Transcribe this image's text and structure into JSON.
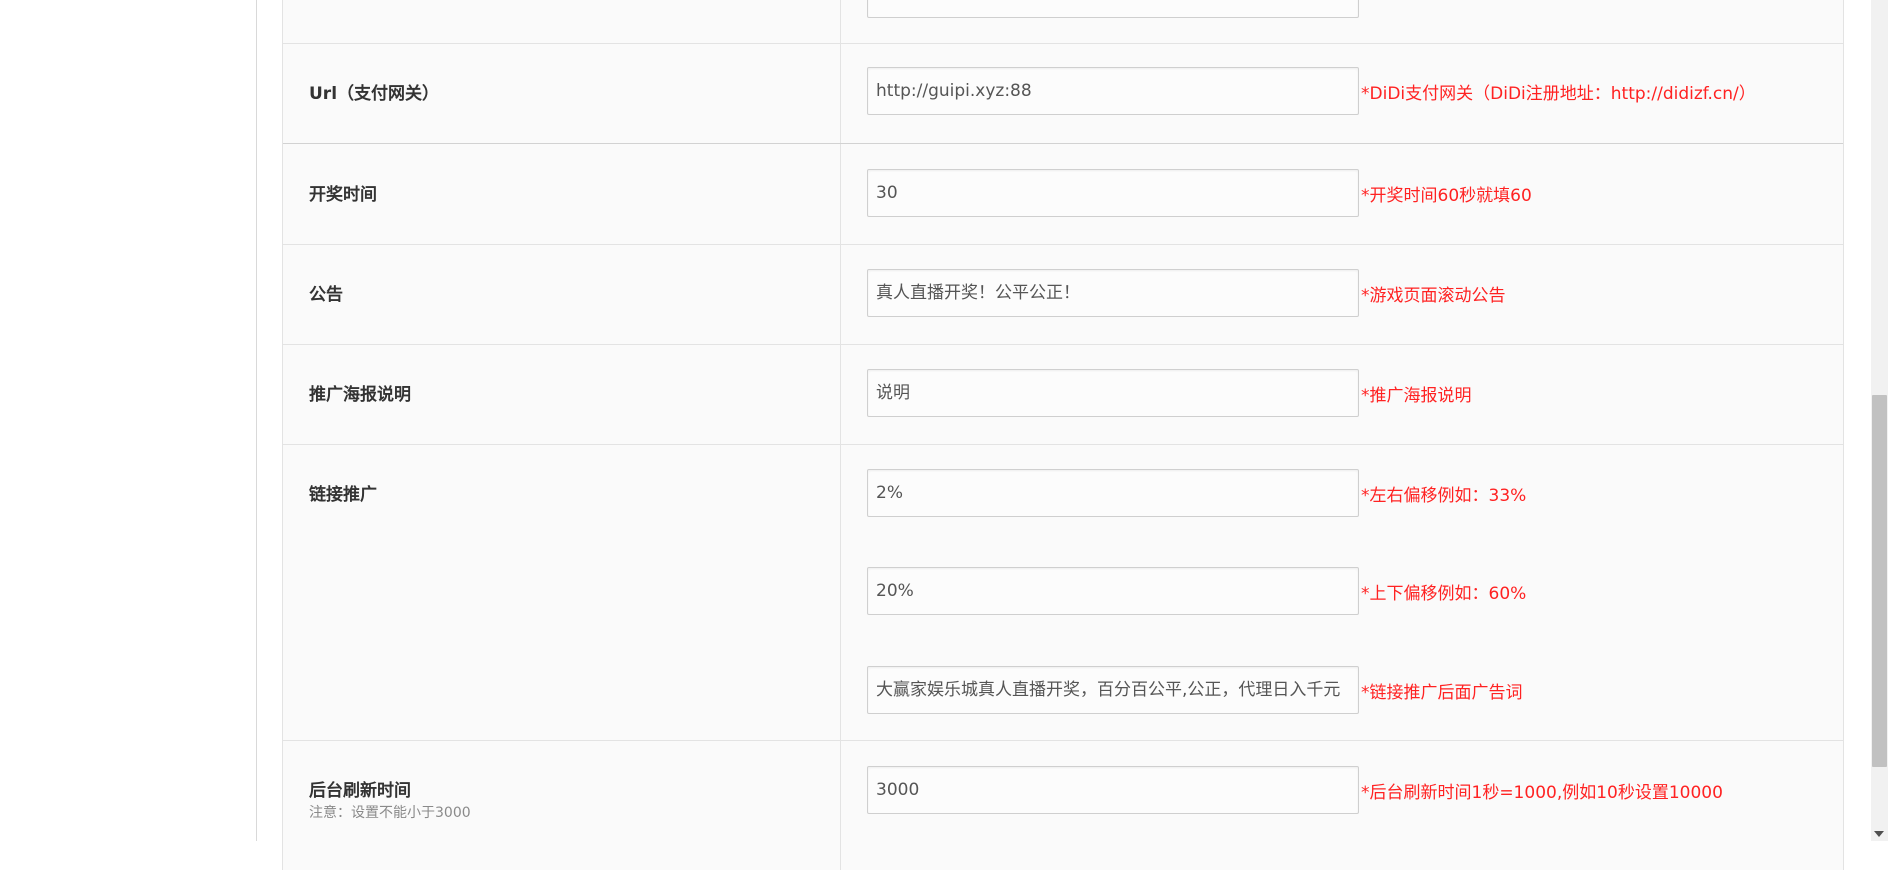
{
  "form": {
    "rows": [
      {
        "label": "Url（支付网关）",
        "fields": [
          {
            "value": "http://guipi.xyz:88",
            "hint": "*DiDi支付网关（DiDi注册地址：http://didizf.cn/）"
          }
        ]
      },
      {
        "label": "开奖时间",
        "fields": [
          {
            "value": "30",
            "hint": "*开奖时间60秒就填60"
          }
        ]
      },
      {
        "label": "公告",
        "fields": [
          {
            "value": "真人直播开奖！公平公正！",
            "hint": "*游戏页面滚动公告"
          }
        ]
      },
      {
        "label": "推广海报说明",
        "fields": [
          {
            "value": "说明",
            "hint": "*推广海报说明"
          }
        ]
      },
      {
        "label": "链接推广",
        "fields": [
          {
            "value": "2%",
            "hint": "*左右偏移例如：33%"
          },
          {
            "value": "20%",
            "hint": "*上下偏移例如：60%"
          },
          {
            "value": "大赢家娱乐城真人直播开奖，百分百公平,公正，代理日入千元",
            "hint": "*链接推广后面广告词"
          }
        ]
      },
      {
        "label": "后台刷新时间",
        "note": "注意：设置不能小于3000",
        "fields": [
          {
            "value": "3000",
            "hint": "*后台刷新时间1秒=1000,例如10秒设置10000"
          }
        ]
      }
    ]
  }
}
